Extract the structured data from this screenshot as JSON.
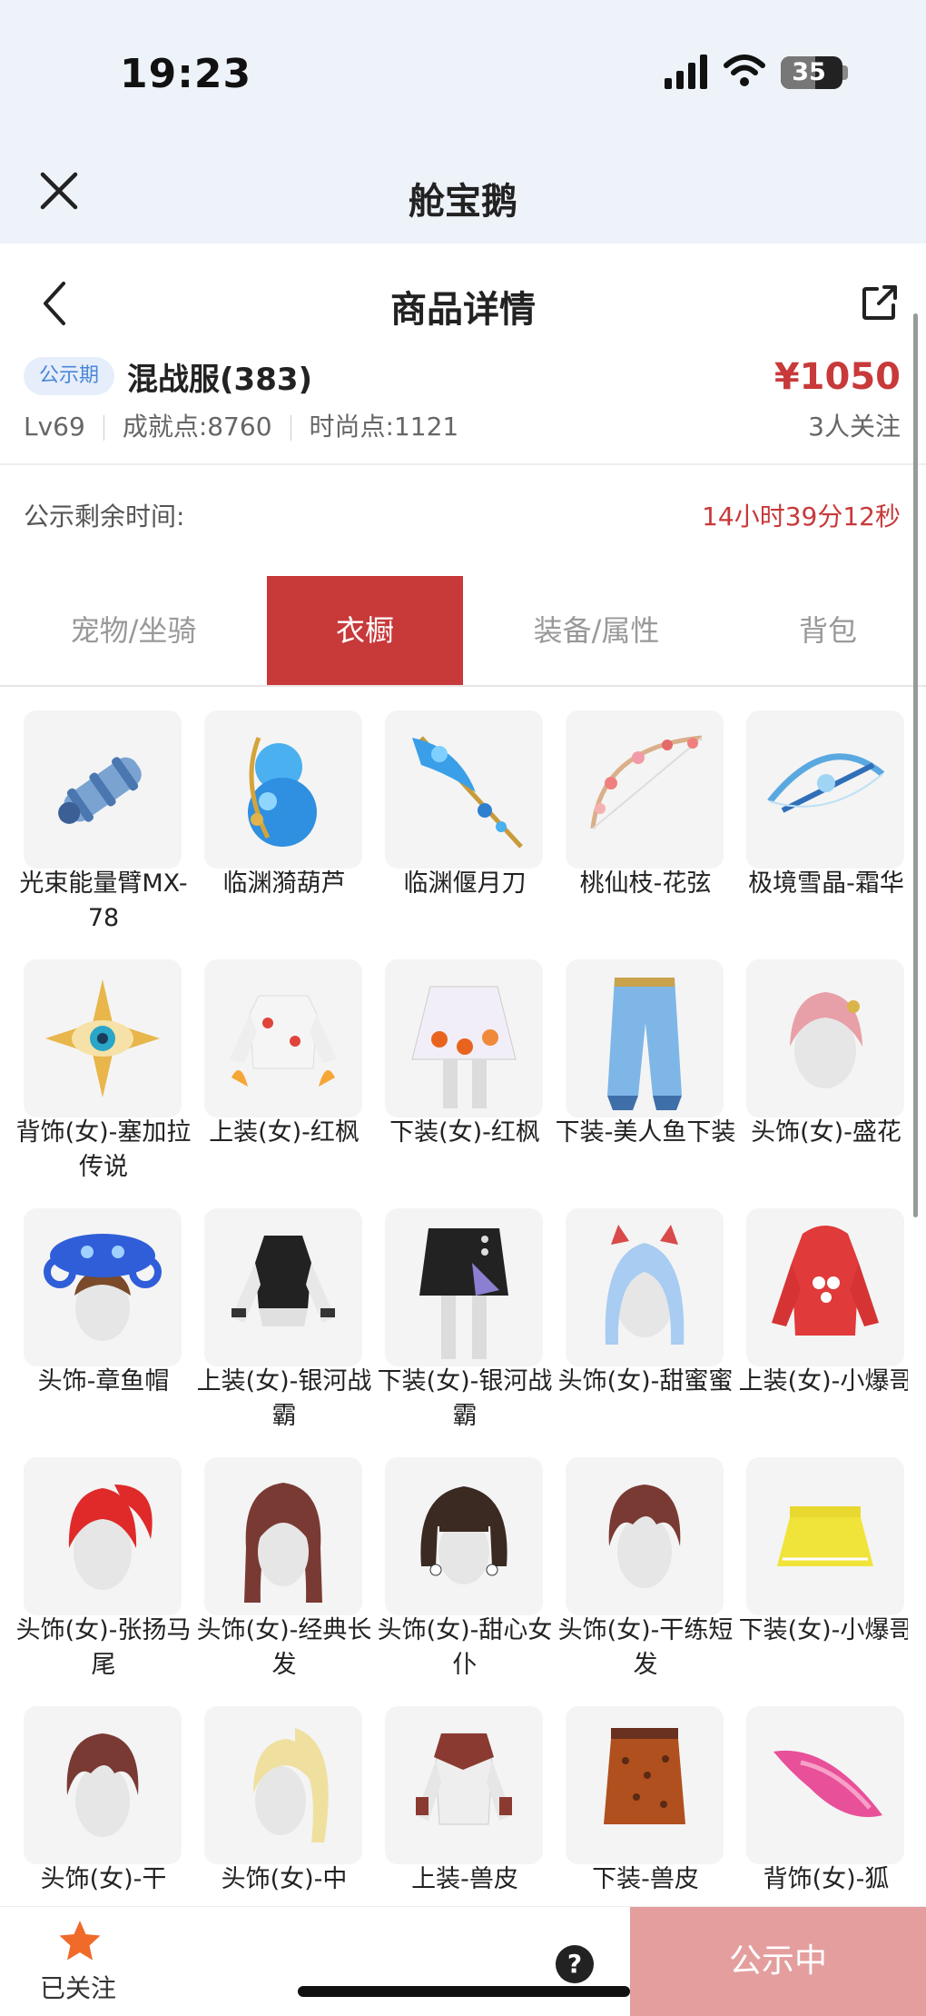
{
  "status_bar": {
    "time": "19:23",
    "battery": "35"
  },
  "app_bar": {
    "title": "舱宝鹅",
    "close_icon": "close-icon"
  },
  "nav": {
    "title": "商品详情",
    "back_icon": "chevron-left-icon",
    "share_icon": "share-icon"
  },
  "product": {
    "badge": "公示期",
    "server": "混战服(383)",
    "price": "¥1050",
    "level": "Lv69",
    "achievement": "成就点:8760",
    "fashion": "时尚点:1121",
    "followers": "3人关注",
    "remain_label": "公示剩余时间:",
    "remain_value": "14小时39分12秒"
  },
  "tabs": [
    {
      "label": "宠物/坐骑",
      "active": false
    },
    {
      "label": "衣橱",
      "active": true
    },
    {
      "label": "装备/属性",
      "active": false
    },
    {
      "label": "背包",
      "active": false
    }
  ],
  "items": [
    {
      "name": "光束能量臂MX-78",
      "icon": "energy-arm-icon"
    },
    {
      "name": "临渊漪葫芦",
      "icon": "gourd-icon"
    },
    {
      "name": "临渊偃月刀",
      "icon": "glaive-icon"
    },
    {
      "name": "桃仙枝-花弦",
      "icon": "bow-icon"
    },
    {
      "name": "极境雪晶-霜华",
      "icon": "crossbow-icon"
    },
    {
      "name": "背饰(女)-塞加拉传说",
      "icon": "eye-ornament-icon"
    },
    {
      "name": "上装(女)-红枫",
      "icon": "top-outfit-icon"
    },
    {
      "name": "下装(女)-红枫",
      "icon": "skirt-icon"
    },
    {
      "name": "下装-美人鱼下装",
      "icon": "pants-icon"
    },
    {
      "name": "头饰(女)-盛花",
      "icon": "hair-icon"
    },
    {
      "name": "头饰-章鱼帽",
      "icon": "octopus-hat-icon"
    },
    {
      "name": "上装(女)-银河战霸",
      "icon": "top-outfit-icon"
    },
    {
      "name": "下装(女)-银河战霸",
      "icon": "skirt-icon"
    },
    {
      "name": "头饰(女)-甜蜜蜜",
      "icon": "hair-icon"
    },
    {
      "name": "上装(女)-小爆哥",
      "icon": "hoodie-icon"
    },
    {
      "name": "头饰(女)-张扬马尾",
      "icon": "hair-icon"
    },
    {
      "name": "头饰(女)-经典长发",
      "icon": "hair-icon"
    },
    {
      "name": "头饰(女)-甜心女仆",
      "icon": "hair-icon"
    },
    {
      "name": "头饰(女)-干练短发",
      "icon": "hair-icon"
    },
    {
      "name": "下装(女)-小爆哥",
      "icon": "skirt-icon"
    },
    {
      "name": "头饰(女)-干",
      "icon": "hair-icon"
    },
    {
      "name": "头饰(女)-中",
      "icon": "hair-icon"
    },
    {
      "name": "上装-兽皮",
      "icon": "top-outfit-icon"
    },
    {
      "name": "下装-兽皮",
      "icon": "skirt-icon"
    },
    {
      "name": "背饰(女)-狐",
      "icon": "tail-icon"
    }
  ],
  "bottom": {
    "followed": "已关注",
    "star_icon": "star-icon",
    "help_icon": "help-icon",
    "help": "?",
    "cta": "公示中"
  },
  "colors": {
    "accent": "#c8393a",
    "cta_disabled": "#e49e9e",
    "header_bg": "#edf3f8",
    "badge_bg": "#e6eefb",
    "badge_text": "#4a86d9",
    "star": "#f06a2a"
  }
}
